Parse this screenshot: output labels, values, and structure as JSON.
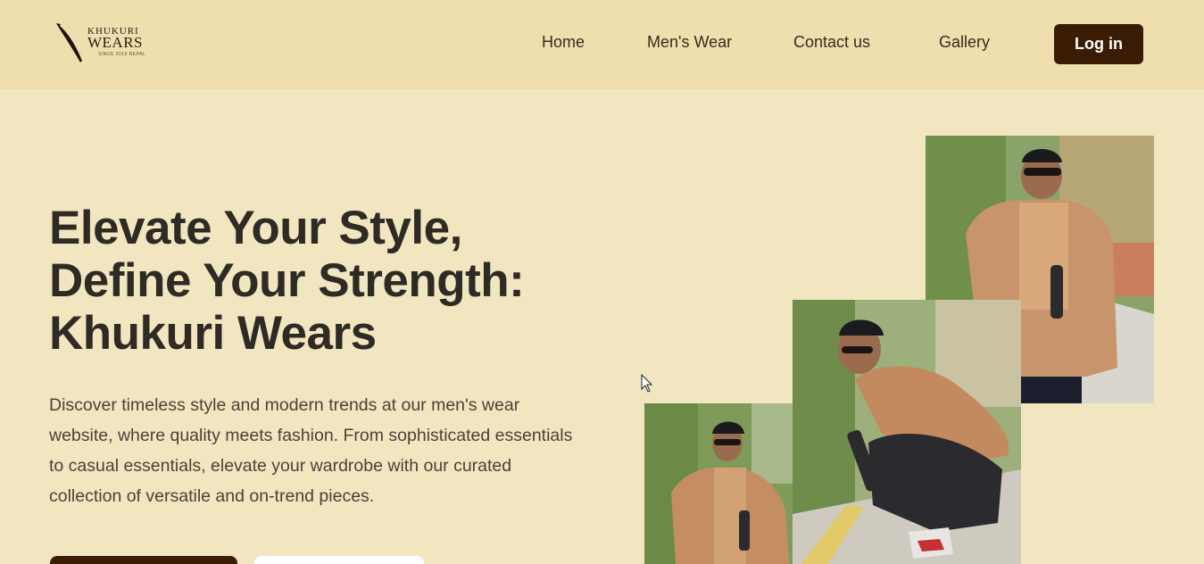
{
  "brand": {
    "line1": "KHUKURI",
    "line2": "WEARS",
    "tagline": "SINCE 2019 NEPAL"
  },
  "nav": {
    "items": [
      {
        "label": "Home"
      },
      {
        "label": "Men's Wear"
      },
      {
        "label": "Contact us"
      },
      {
        "label": "Gallery"
      }
    ],
    "login_label": "Log in"
  },
  "hero": {
    "title_lines": [
      "Elevate Your Style,",
      "Define Your Strength:",
      "Khukuri Wears"
    ],
    "description": "Discover timeless style and modern trends at our men's wear website, where quality meets fashion. From sophisticated essentials to casual essentials, elevate your wardrobe with our curated collection of versatile and on-trend pieces."
  },
  "colors": {
    "header_bg": "#efdfaf",
    "page_bg": "#f1e6c0",
    "accent_dark": "#3a1c05",
    "heading_text": "#2e2a24",
    "body_text": "#4b4237"
  },
  "icons": {
    "logo": "khukuri-blade-icon",
    "cursor": "mouse-pointer-icon"
  }
}
